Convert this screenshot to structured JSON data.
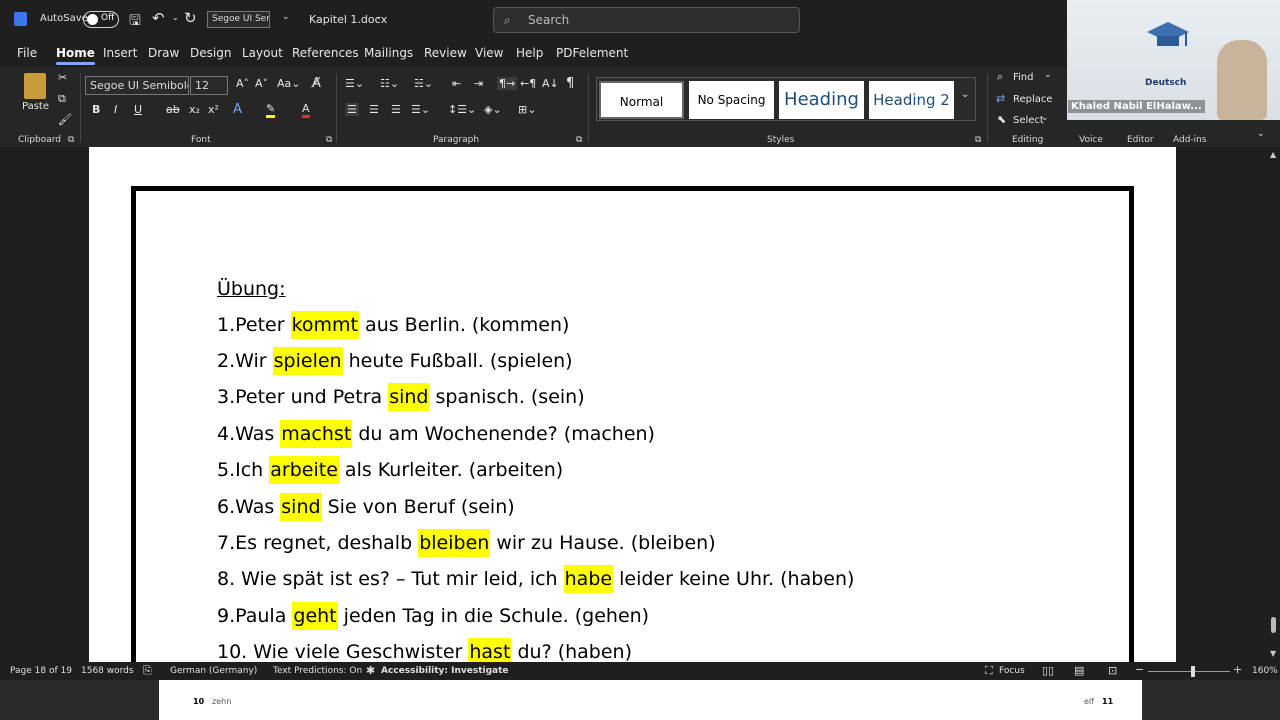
{
  "titlebar": {
    "autosave_label": "AutoSave",
    "autosave_state": "Off",
    "font_name": "Segoe UI Ser",
    "doc_title": "Kapitel 1.docx",
    "search_placeholder": "Search"
  },
  "tabs": [
    "File",
    "Home",
    "Insert",
    "Draw",
    "Design",
    "Layout",
    "References",
    "Mailings",
    "Review",
    "View",
    "Help",
    "PDFelement"
  ],
  "active_tab": "Home",
  "ribbon": {
    "paste_label": "Paste",
    "font_name": "Segoe UI Semibold",
    "font_size": "12",
    "groups": {
      "clipboard": "Clipboard",
      "font": "Font",
      "paragraph": "Paragraph",
      "styles": "Styles",
      "editing": "Editing",
      "voice": "Voice",
      "editor": "Editor",
      "addins": "Add-ins"
    },
    "styles": [
      "Normal",
      "No Spacing",
      "Heading",
      "Heading 2"
    ],
    "find": "Find",
    "replace": "Replace",
    "select": "Select"
  },
  "video": {
    "participant": "Khaled Nabil ElHalaw...",
    "logo_text": "Deutsch"
  },
  "document": {
    "heading": "Übung:",
    "lines": [
      {
        "pre": "1.Peter ",
        "hl": "kommt",
        "post": " aus Berlin. (kommen)"
      },
      {
        "pre": "2.Wir ",
        "hl": "spielen",
        "post": " heute Fußball. (spielen)"
      },
      {
        "pre": "3.Peter und Petra ",
        "hl": "sind",
        "post": " spanisch. (sein)"
      },
      {
        "pre": "4.Was ",
        "hl": "machst",
        "post": " du am Wochenende? (machen)"
      },
      {
        "pre": "5.Ich ",
        "hl": "arbeite",
        "post": " als Kurleiter. (arbeiten)"
      },
      {
        "pre": "6.Was ",
        "hl": "sind",
        "post": " Sie von Beruf (sein)"
      },
      {
        "pre": "7.Es regnet, deshalb ",
        "hl": "bleiben",
        "post": " wir zu Hause. (bleiben)"
      },
      {
        "pre": "8. Wie spät ist es? – Tut mir leid, ich ",
        "hl": "habe",
        "post": " leider keine Uhr.  (haben)"
      },
      {
        "pre": "9.Paula ",
        "hl": "geht",
        "post": " jeden Tag in die Schule. (gehen)"
      },
      {
        "pre": "10. Wie viele Geschwister ",
        "hl": "hast",
        "post": " du?  (haben)"
      }
    ]
  },
  "status": {
    "page": "Page 18 of 19",
    "words": "1568 words",
    "language": "German (Germany)",
    "predictions": "Text Predictions: On",
    "accessibility": "Accessibility: Investigate",
    "focus": "Focus",
    "zoom": "160%"
  },
  "below_page": {
    "left_num": "10",
    "left_word": "zehn",
    "right_word": "elf",
    "right_num": "11"
  }
}
